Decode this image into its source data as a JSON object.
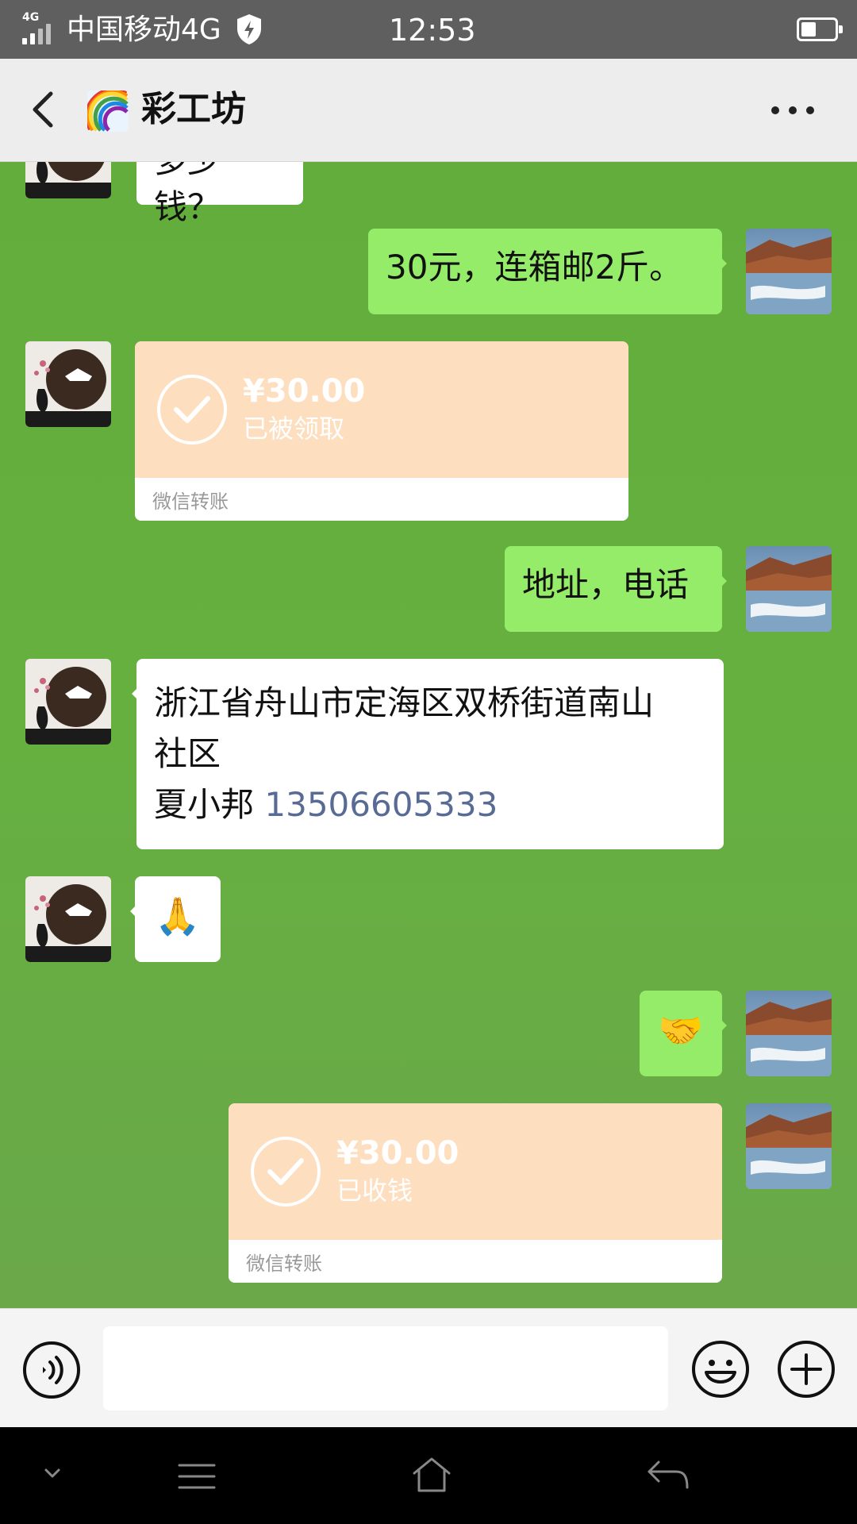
{
  "status_bar": {
    "network_type": "4G",
    "carrier": "中国移动4G",
    "time": "12:53",
    "battery_level": 0.45
  },
  "header": {
    "title": "彩工坊",
    "back_icon": "chevron-left-icon",
    "more_icon": "more-dots-icon",
    "group_icon": "rainbow-icon"
  },
  "messages": [
    {
      "side": "left",
      "type": "text",
      "text": "多少钱？"
    },
    {
      "side": "right",
      "type": "text",
      "text": "30元，连箱邮2斤。"
    },
    {
      "side": "left",
      "type": "transfer",
      "amount": "¥30.00",
      "status": "已被领取",
      "label": "微信转账"
    },
    {
      "side": "right",
      "type": "text",
      "text": "地址，电话"
    },
    {
      "side": "left",
      "type": "address",
      "line1": "浙江省舟山市定海区双桥街道南山",
      "line2": "社区",
      "name": "夏小邦",
      "phone": "13506605333"
    },
    {
      "side": "left",
      "type": "emoji",
      "emoji": "🙏"
    },
    {
      "side": "right",
      "type": "emoji",
      "emoji": "🤝"
    },
    {
      "side": "right",
      "type": "transfer",
      "amount": "¥30.00",
      "status": "已收钱",
      "label": "微信转账"
    }
  ],
  "input_bar": {
    "placeholder": "",
    "voice_icon": "voice-icon",
    "emoji_icon": "smiley-icon",
    "plus_icon": "plus-icon"
  },
  "nav_bar": {
    "icons": [
      "chevron-down-icon",
      "menu-icon",
      "home-icon",
      "back-arrow-icon"
    ]
  },
  "colors": {
    "chat_bg": "#66b040",
    "bubble_self": "#95ec69",
    "bubble_other": "#ffffff",
    "transfer_bg": "#fddebf",
    "link": "#576b95"
  }
}
